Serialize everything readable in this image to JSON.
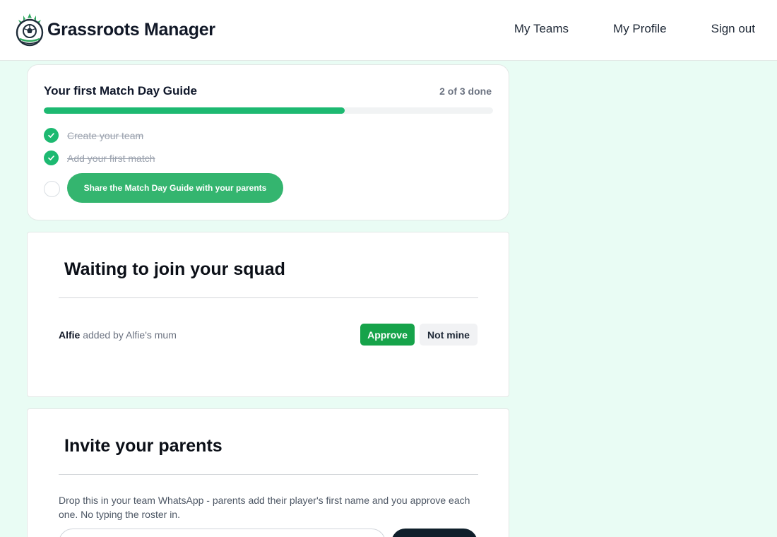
{
  "header": {
    "brand_name": "Grassroots Manager",
    "logo_icon": "football-crest-icon",
    "nav": [
      {
        "label": "My Teams"
      },
      {
        "label": "My Profile"
      },
      {
        "label": "Sign out"
      }
    ]
  },
  "guide": {
    "title": "Your first Match Day Guide",
    "progress_text": "2 of 3 done",
    "progress_fraction": 0.67,
    "steps": [
      {
        "label": "Create your team",
        "done": true
      },
      {
        "label": "Add your first match",
        "done": true
      },
      {
        "label": "Share the Match Day Guide with your parents",
        "done": false
      }
    ]
  },
  "squad": {
    "title": "Waiting to join your squad",
    "requests": [
      {
        "name": "Alfie",
        "added_by": "added by Alfie's mum",
        "approve_label": "Approve",
        "reject_label": "Not mine"
      }
    ]
  },
  "invite": {
    "title": "Invite your parents",
    "description": "Drop this in your team WhatsApp - parents add their player's first name and you approve each one. No typing the roster in.",
    "link_value": "",
    "button_label": ""
  },
  "colors": {
    "background": "#e9fcf4",
    "accent": "#1db971",
    "approve": "#16a34a",
    "dark_button": "#0f1f2b"
  }
}
